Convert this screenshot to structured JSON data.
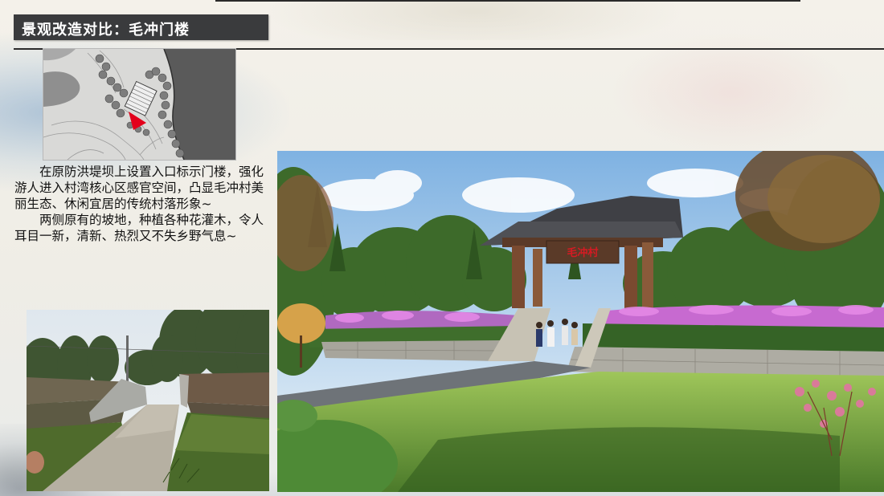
{
  "header": {
    "title": "景观改造对比：毛冲门楼"
  },
  "description": {
    "paragraphs": [
      "在原防洪堤坝上设置入口标示门楼，强化游人进入村湾核心区感官空间，凸显毛冲村美丽生态、休闲宜居的传统村落形象~",
      "两侧原有的坡地，种植各种花灌木，令人耳目一新，清新、热烈又不失乡野气息~"
    ]
  },
  "images": {
    "location_map": {
      "icon": "map-location-marker-icon",
      "marker_color": "#e3001b"
    },
    "before_photo": {},
    "after_rendering": {
      "gate_sign": "毛冲村"
    }
  },
  "colors": {
    "title_bar": "#3a3b3d",
    "title_text": "#ffffff",
    "rule": "#2b2b2b"
  }
}
